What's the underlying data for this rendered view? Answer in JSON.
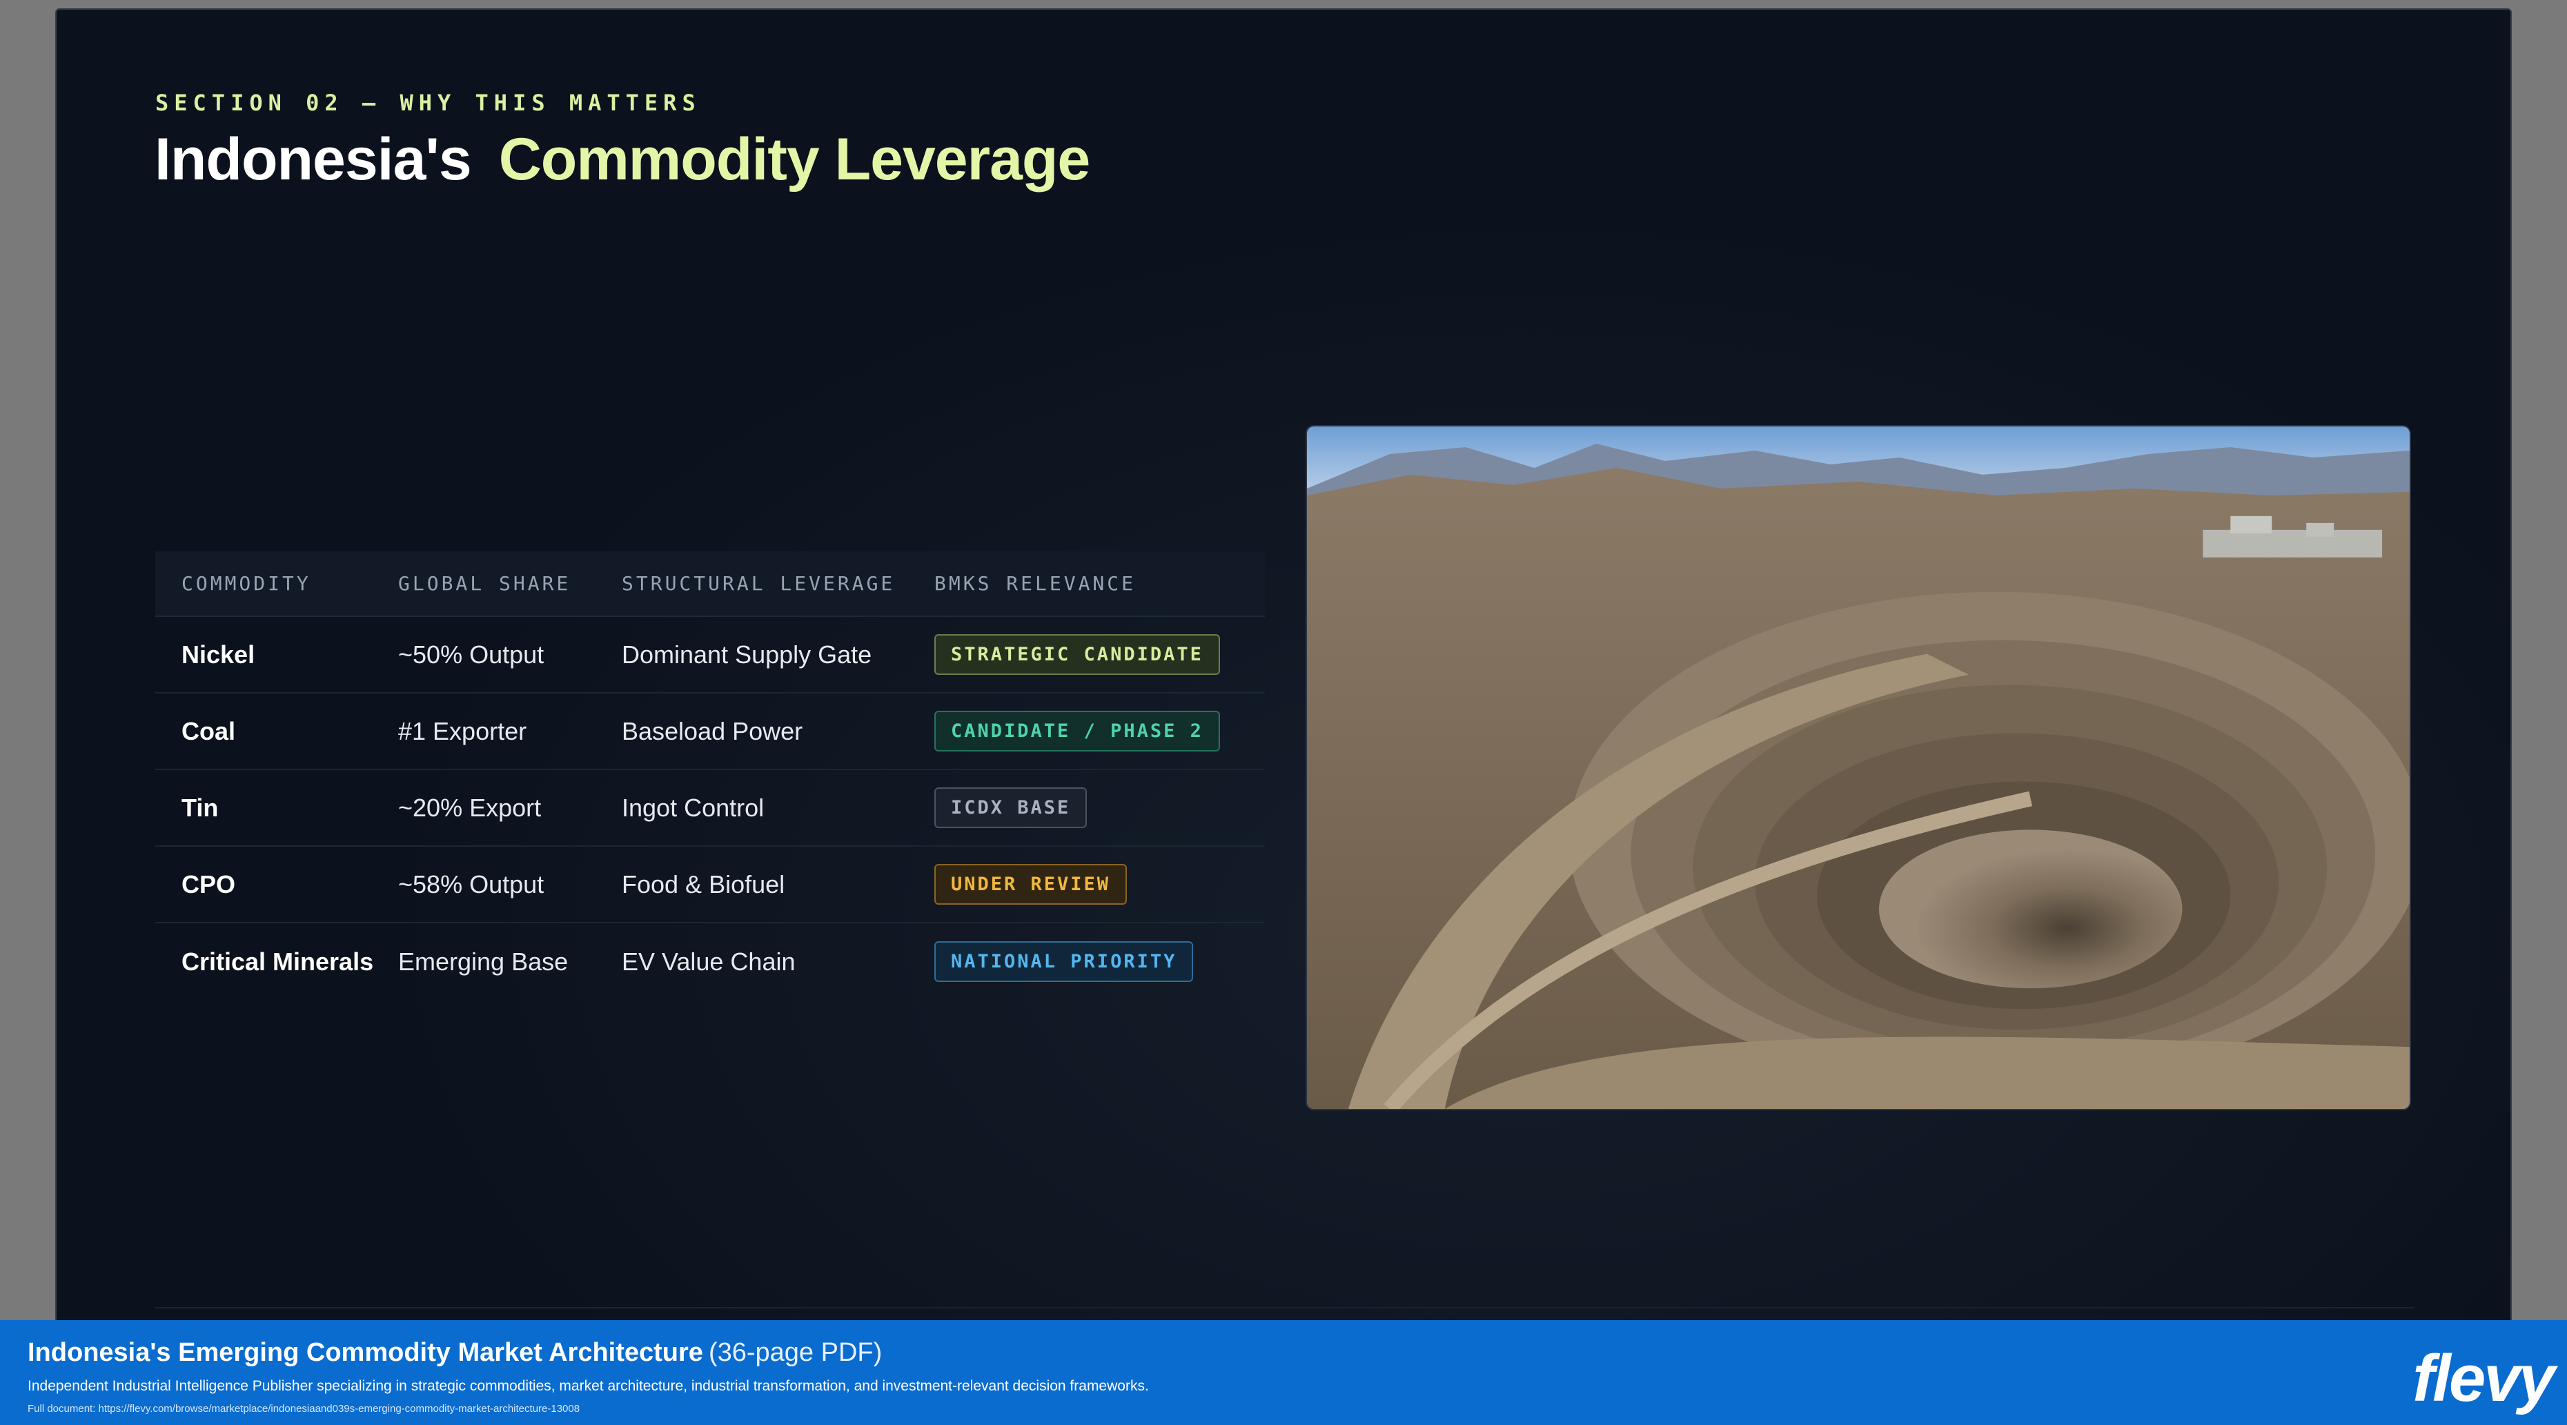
{
  "section": {
    "label": "SECTION 02 — WHY THIS MATTERS",
    "title_part1": "Indonesia's",
    "title_part2": "Commodity Leverage"
  },
  "table": {
    "headers": [
      "COMMODITY",
      "GLOBAL SHARE",
      "STRUCTURAL LEVERAGE",
      "BMKS RELEVANCE"
    ],
    "rows": [
      {
        "commodity": "Nickel",
        "share": "~50% Output",
        "leverage": "Dominant Supply Gate",
        "relevance": "STRATEGIC CANDIDATE",
        "badge_color": "#d6ee9c"
      },
      {
        "commodity": "Coal",
        "share": "#1 Exporter",
        "leverage": "Baseload Power",
        "relevance": "CANDIDATE / PHASE 2",
        "badge_color": "#4ed3b0"
      },
      {
        "commodity": "Tin",
        "share": "~20% Export",
        "leverage": "Ingot Control",
        "relevance": "ICDX BASE",
        "badge_color": "#aab3c2"
      },
      {
        "commodity": "CPO",
        "share": "~58% Output",
        "leverage": "Food & Biofuel",
        "relevance": "UNDER REVIEW",
        "badge_color": "#f2b83c"
      },
      {
        "commodity": "Critical Minerals",
        "share": "Emerging Base",
        "leverage": "EV Value Chain",
        "relevance": "NATIONAL PRIORITY",
        "badge_color": "#55b6f0"
      }
    ]
  },
  "image": {
    "subject": "open-pit-mine-photo"
  },
  "banner": {
    "title": "Indonesia's Emerging Commodity Market Architecture",
    "pages": "(36-page PDF)",
    "description": "Independent Industrial Intelligence Publisher specializing in strategic commodities, market architecture, industrial transformation, and investment-relevant decision frameworks.",
    "link": "Full document: https://flevy.com/browse/marketplace/indonesiaand039s-emerging-commodity-market-architecture-13008",
    "logo": "flevy"
  },
  "colors": {
    "background": "#0c121d",
    "accent": "#e3f6a8",
    "banner": "#0a6ccf"
  }
}
